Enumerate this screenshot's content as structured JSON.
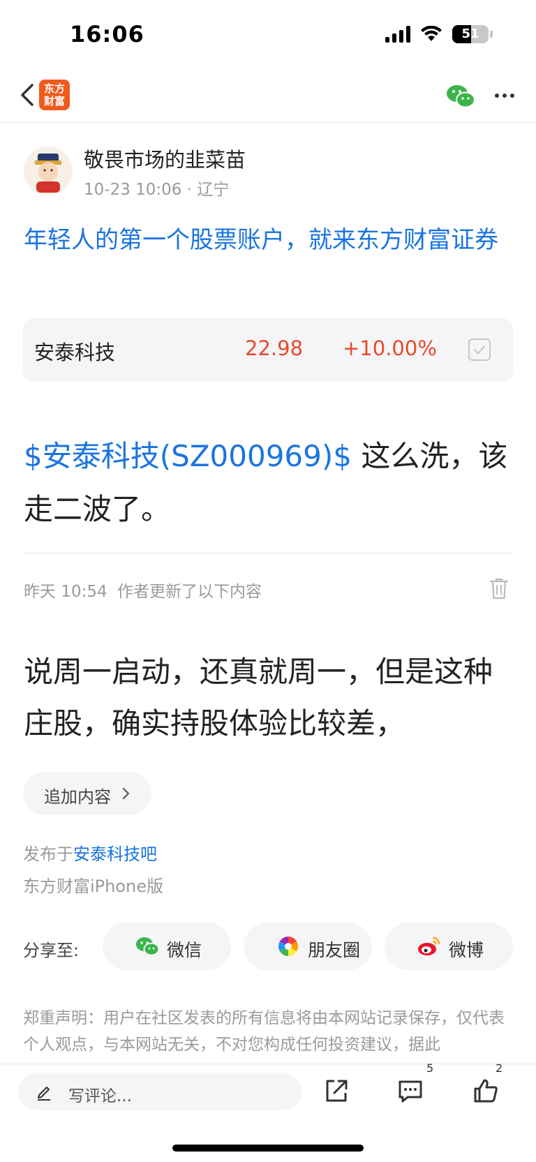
{
  "status_bar": {
    "time": "16:06",
    "battery_level": 51,
    "battery_text": "51",
    "icons": [
      "signal-icon",
      "wifi-icon",
      "battery-icon"
    ]
  },
  "nav": {
    "app_logo_text": "东方财富",
    "icons": [
      "back-chevron-icon",
      "wechat-icon",
      "more-dots-icon"
    ]
  },
  "post": {
    "author": "敬畏市场的韭菜苗",
    "meta": "10-23 10:06 · 辽宁",
    "promo_link": "年轻人的第一个股票账户，就来东方财富证券",
    "stock": {
      "name": "安泰科技",
      "price": "22.98",
      "change": "+10.00%"
    },
    "body_stock_tag": "$安泰科技(SZ000969)$",
    "body_text": " 这么洗，该走二波了。",
    "update_time": "昨天 10:54",
    "update_note": "作者更新了以下内容",
    "update_body": "说周一启动，还真就周一，但是这种庄股，确实持股体验比较差，",
    "add_content_label": "追加内容",
    "posted_in_prefix": "发布于",
    "posted_in_forum": "安泰科技吧",
    "client_info": "东方财富iPhone版"
  },
  "share": {
    "label": "分享至:",
    "buttons": [
      {
        "label": "微信",
        "icon": "wechat-icon"
      },
      {
        "label": "朋友圈",
        "icon": "moments-icon"
      },
      {
        "label": "微博",
        "icon": "weibo-icon"
      }
    ]
  },
  "disclaimer": "郑重声明：用户在社区发表的所有信息将由本网站记录保存，仅代表个人观点，与本网站无关，不对您构成任何投资建议，据此",
  "bottom_bar": {
    "comment_placeholder": "写评论...",
    "comment_count": "5",
    "like_count": "2"
  },
  "colors": {
    "link_blue": "#1a74e0",
    "price_red": "#e94a2a",
    "wechat_green": "#3bb54a",
    "brand_orange": "#f05a1d"
  }
}
